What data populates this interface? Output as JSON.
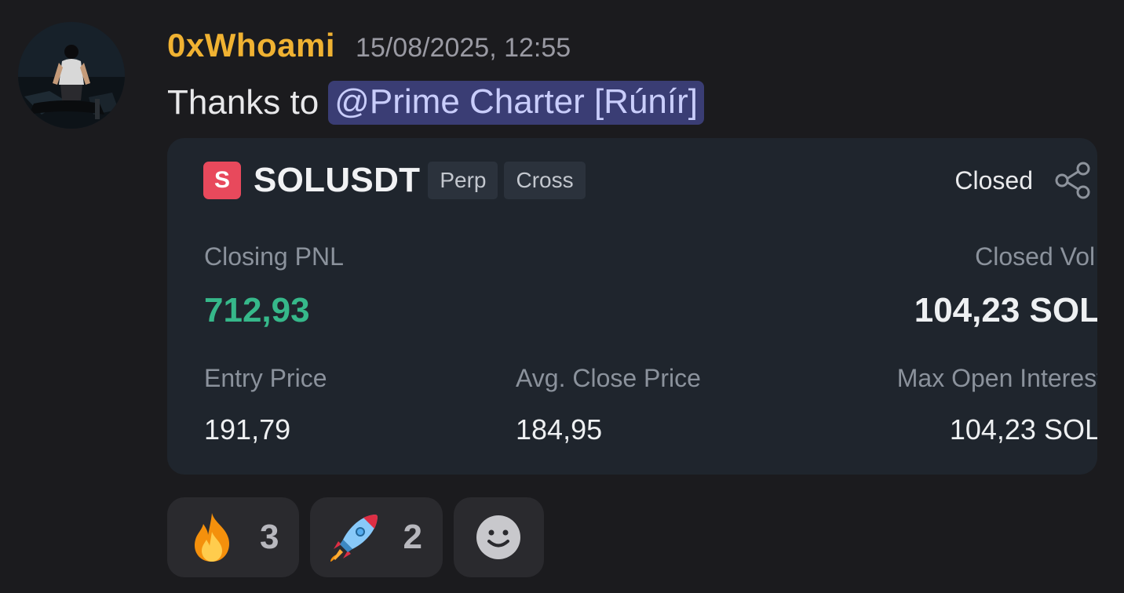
{
  "message": {
    "author": "0xWhoami",
    "timestamp": "15/08/2025, 12:55",
    "text": "Thanks to",
    "mention": "@Prime Charter [Rúnír]"
  },
  "trade_card": {
    "symbol_icon_letter": "S",
    "symbol": "SOLUSDT",
    "tags": [
      "Perp",
      "Cross"
    ],
    "status": "Closed",
    "closing_pnl_label": "Closing PNL",
    "closing_pnl_value": "712,93",
    "closed_vol_label": "Closed Vol.",
    "closed_vol_value": "104,23 SOL",
    "entry_price_label": "Entry Price",
    "entry_price_value": "191,79",
    "avg_close_label": "Avg. Close Price",
    "avg_close_value": "184,95",
    "max_oi_label": "Max Open Interest",
    "max_oi_value": "104,23 SOL"
  },
  "reactions": [
    {
      "emoji": "fire-icon",
      "count": "3"
    },
    {
      "emoji": "rocket-icon",
      "count": "2"
    }
  ],
  "colors": {
    "username": "#f0b232",
    "mention_bg": "#3a3d74",
    "pnl_green": "#36b88a",
    "symbol_icon": "#e8495c"
  }
}
